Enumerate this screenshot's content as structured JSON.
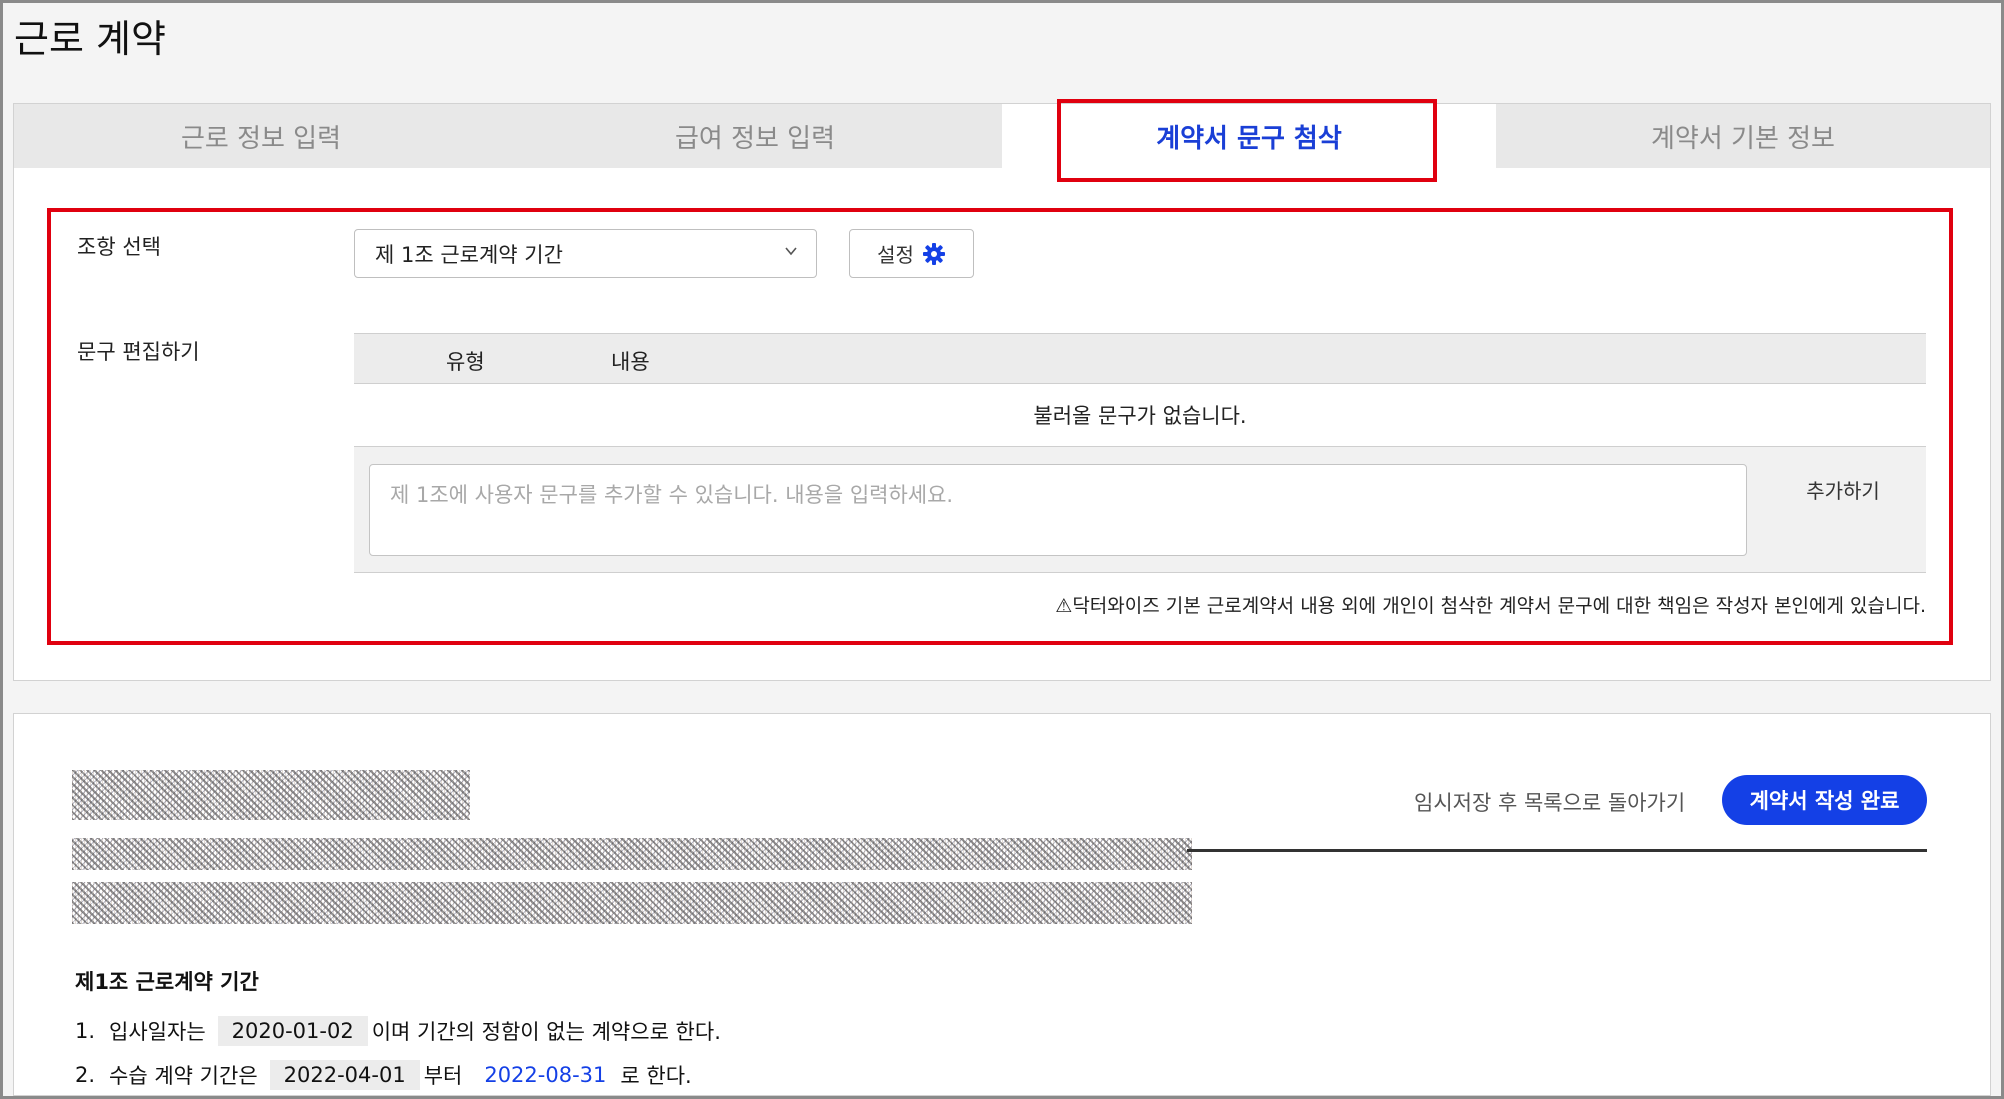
{
  "page": {
    "title": "근로 계약"
  },
  "tabs": [
    {
      "label": "근로 정보 입력",
      "active": false
    },
    {
      "label": "급여 정보 입력",
      "active": false
    },
    {
      "label": "계약서 문구 첨삭",
      "active": true
    },
    {
      "label": "계약서 기본 정보",
      "active": false
    }
  ],
  "clause_select": {
    "label": "조항 선택",
    "selected": "제 1조 근로계약 기간",
    "settings_label": "설정"
  },
  "phrase_edit": {
    "label": "문구 편집하기",
    "columns": [
      "유형",
      "내용"
    ],
    "empty_message": "불러올 문구가 없습니다.",
    "input_placeholder": "제 1조에 사용자 문구를 추가할 수 있습니다. 내용을 입력하세요.",
    "add_label": "추가하기",
    "notice": "⚠닥터와이즈 기본 근로계약서 내용 외에 개인이 첨삭한 계약서 문구에 대한 책임은 작성자 본인에게 있습니다."
  },
  "actions": {
    "save_and_back": "임시저장 후 목록으로 돌아가기",
    "complete": "계약서 작성 완료"
  },
  "contract": {
    "article_title": "제1조 근로계약 기간",
    "clause1": {
      "num": "1.",
      "prefix": "입사일자는",
      "date": "2020-01-02",
      "suffix": "이며 기간의 정함이 없는 계약으로 한다."
    },
    "clause2": {
      "num": "2.",
      "prefix": "수습 계약 기간은",
      "start": "2022-04-01",
      "middle": "부터",
      "end": "2022-08-31",
      "suffix": "로 한다."
    }
  },
  "colors": {
    "accent": "#1440e6",
    "highlight": "#e0000f"
  }
}
